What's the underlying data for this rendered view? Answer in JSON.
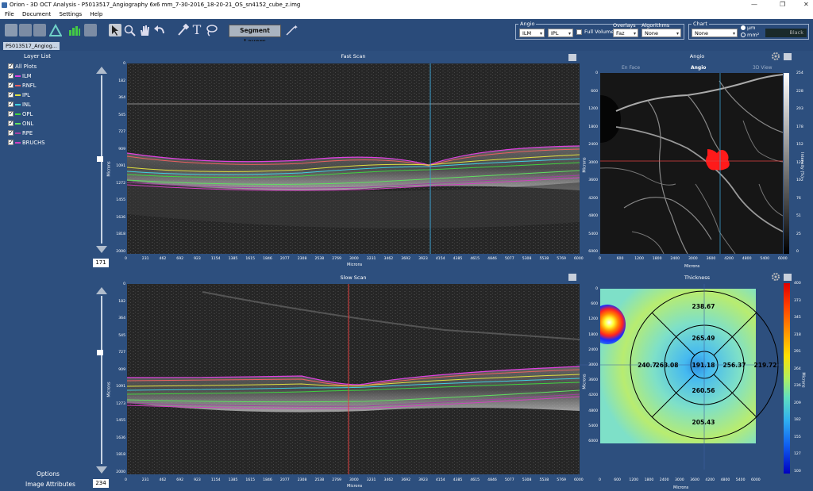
{
  "window": {
    "title": "Orion - 3D OCT Analysis - P5013517_Angiography 6x6 mm_7-30-2016_18-20-21_OS_sn4152_cube_z.img",
    "min": "—",
    "restore": "❐",
    "close": "✕"
  },
  "menu": [
    "File",
    "Document",
    "Settings",
    "Help"
  ],
  "toolbar": {
    "segment_layers": "Segment Layers"
  },
  "tab": {
    "label": "P5013517_Angiog..."
  },
  "angio_group": {
    "label": "Angio",
    "layer1": "ILM",
    "layer2": "IPL",
    "full_volume": "Full Volume",
    "overlays_label": "Overlays",
    "overlays_value": "Faz",
    "algorithms_label": "Algorithms",
    "algorithms_value": "None"
  },
  "chart_group": {
    "label": "Chart",
    "value": "None",
    "unit1": "μm",
    "unit2": "mm²",
    "color": "Black"
  },
  "layer_list": {
    "title": "Layer List",
    "all": "All Plots",
    "items": [
      {
        "label": "ILM",
        "color": "#e040e0"
      },
      {
        "label": "RNFL",
        "color": "#e86060"
      },
      {
        "label": "IPL",
        "color": "#e0e040"
      },
      {
        "label": "INL",
        "color": "#40d0e0"
      },
      {
        "label": "OPL",
        "color": "#40d040"
      },
      {
        "label": "ONL",
        "color": "#60e060"
      },
      {
        "label": "RPE",
        "color": "#a040a0"
      },
      {
        "label": "BRUCHS",
        "color": "#d040c0"
      }
    ]
  },
  "footer": {
    "options": "Options",
    "image_attributes": "Image Attributes"
  },
  "fast_scan": {
    "title": "Fast Scan",
    "slider_value": "171",
    "xlabel": "Microns",
    "ylabel": "Microns",
    "yticks": [
      "0",
      "182",
      "364",
      "545",
      "727",
      "909",
      "1091",
      "1272",
      "1455",
      "1636",
      "1818",
      "2000"
    ],
    "xticks": [
      "0",
      "231",
      "462",
      "692",
      "923",
      "1154",
      "1385",
      "1615",
      "1846",
      "2077",
      "2308",
      "2538",
      "2769",
      "3000",
      "3231",
      "3462",
      "3692",
      "3923",
      "4154",
      "4385",
      "4615",
      "4846",
      "5077",
      "5308",
      "5538",
      "5769",
      "6000"
    ]
  },
  "slow_scan": {
    "title": "Slow Scan",
    "slider_value": "234",
    "xlabel": "Microns",
    "ylabel": "Microns",
    "yticks": [
      "0",
      "182",
      "364",
      "545",
      "727",
      "909",
      "1091",
      "1273",
      "1455",
      "1636",
      "1818",
      "2000"
    ],
    "xticks": [
      "0",
      "231",
      "462",
      "692",
      "923",
      "1154",
      "1385",
      "1615",
      "1846",
      "2077",
      "2308",
      "2538",
      "2769",
      "3000",
      "3231",
      "3462",
      "3692",
      "3923",
      "4154",
      "4385",
      "4615",
      "4846",
      "5077",
      "5308",
      "5538",
      "5769",
      "6000"
    ]
  },
  "angio": {
    "title": "Angio",
    "tab_enface": "En Face",
    "tab_angio": "Angio",
    "tab_3d": "3D View",
    "xlabel": "Microns",
    "ylabel": "Microns",
    "cbar_label": "Intensity (%)",
    "yticks": [
      "0",
      "600",
      "1200",
      "1800",
      "2400",
      "3000",
      "3600",
      "4200",
      "4800",
      "5400",
      "6000"
    ],
    "xticks": [
      "0",
      "600",
      "1200",
      "1800",
      "2400",
      "3000",
      "3600",
      "4200",
      "4800",
      "5400",
      "6000"
    ],
    "cbar_ticks": [
      "254",
      "228",
      "203",
      "178",
      "152",
      "127",
      "102",
      "76",
      "51",
      "25",
      "0"
    ]
  },
  "thickness": {
    "title": "Thickness",
    "xlabel": "Microns",
    "ylabel": "Microns",
    "cbar_label": "Microns",
    "yticks": [
      "0",
      "600",
      "1200",
      "1800",
      "2400",
      "3000",
      "3600",
      "4200",
      "4800",
      "5400",
      "6000"
    ],
    "xticks": [
      "0",
      "600",
      "1200",
      "1800",
      "2400",
      "3000",
      "3600",
      "4200",
      "4800",
      "5400",
      "6000"
    ],
    "cbar_ticks": [
      "400",
      "373",
      "345",
      "318",
      "291",
      "264",
      "236",
      "209",
      "182",
      "155",
      "127",
      "100"
    ],
    "values": {
      "outer_top": "238.67",
      "inner_top": "265.49",
      "outer_left": "240.7",
      "inner_left": "263.08",
      "center": "191.18",
      "inner_right": "256.37",
      "outer_right": "219.72",
      "inner_bottom": "260.56",
      "outer_bottom": "205.43"
    }
  }
}
